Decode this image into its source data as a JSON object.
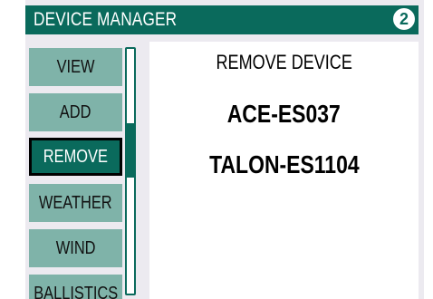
{
  "header": {
    "title": "DEVICE MANAGER",
    "page_number": "2"
  },
  "menu": {
    "items": [
      {
        "label": "VIEW",
        "selected": false
      },
      {
        "label": "ADD",
        "selected": false
      },
      {
        "label": "REMOVE",
        "selected": true
      },
      {
        "label": "WEATHER",
        "selected": false
      },
      {
        "label": "WIND",
        "selected": false
      },
      {
        "label": "BALLISTICS",
        "selected": false
      }
    ]
  },
  "content": {
    "heading": "REMOVE DEVICE",
    "devices": [
      "ACE-ES037",
      "TALON-ES1104"
    ]
  },
  "colors": {
    "accent": "#0a6a5c",
    "menu_item": "#7fb3a9",
    "panel_background": "#eceaf0"
  }
}
